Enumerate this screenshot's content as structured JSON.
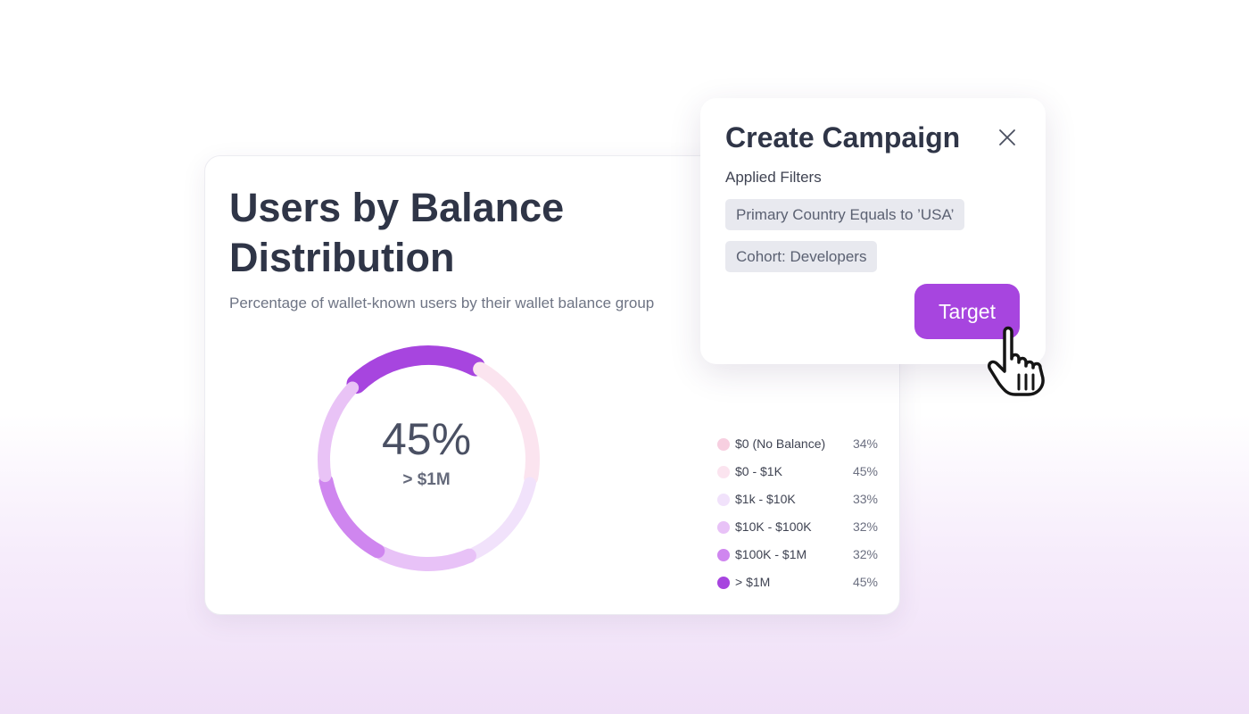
{
  "chart_card": {
    "title": "Users by Balance Distribution",
    "subtitle": "Percentage of wallet-known users by their wallet balance group",
    "center_value": "45%",
    "center_label": "> $1M"
  },
  "chart_data": {
    "type": "pie",
    "title": "Users by Balance Distribution",
    "subtitle": "Percentage of wallet-known users by their wallet balance group",
    "categories": [
      "$0 (No Balance)",
      "$0 - $1K",
      "$1k - $10K",
      "$10K - $100K",
      "$100K - $1M",
      "> $1M"
    ],
    "values": [
      34,
      45,
      33,
      32,
      32,
      45
    ],
    "value_labels": [
      "34%",
      "45%",
      "33%",
      "32%",
      "32%",
      "45%"
    ],
    "colors": [
      "#f7cfe0",
      "#fbe4ef",
      "#f1e2fb",
      "#e8c2f7",
      "#cf86ef",
      "#a745df"
    ],
    "legend": "right"
  },
  "campaign": {
    "title": "Create Campaign",
    "filters_label": "Applied Filters",
    "filters": [
      "Primary Country Equals to ’USA’",
      "Cohort: Developers"
    ],
    "target_label": "Target"
  },
  "icons": {
    "close": "close-icon",
    "cursor": "hand-pointer-icon"
  },
  "colors": {
    "accent": "#a745df",
    "text_dark": "#2f3547"
  }
}
